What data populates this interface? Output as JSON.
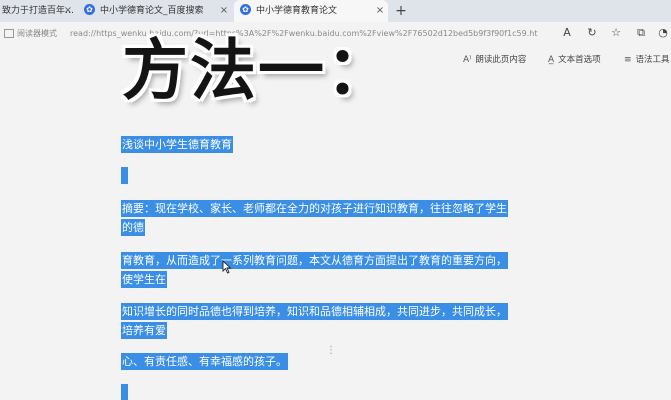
{
  "tabs": [
    {
      "label": "致力于打造百年…",
      "active": false
    },
    {
      "label": "中小学德育论文_百度搜索",
      "active": false
    },
    {
      "label": "中小学德育教育论文",
      "active": true
    }
  ],
  "tab_close_glyph": "×",
  "new_tab_glyph": "+",
  "address": {
    "reader_mode_label": "阅读器模式",
    "url": "read://https_wenku.baidu.com/?url=https%3A%2F%2Fwenku.baidu.com%2Fview%2F76502d12bed5b9f3f90f1c59.ht"
  },
  "toolbar_icons": [
    "read-aloud-icon",
    "refresh-icon",
    "favorites-icon",
    "collections-icon",
    "profile-icon"
  ],
  "toolbar": {
    "read_aloud_label": "朗读此页内容",
    "text_prefs_label": "文本首选项",
    "grammar_tools_label": "语法工具"
  },
  "overlay_title": "方法一：",
  "document": {
    "lines": [
      "浅谈中小学生德育教育",
      "摘要：现在学校、家长、老师都在全力的对孩子进行知识教育，往往忽略了学生",
      "的德",
      "育教育，从而造成了一系列教育问题，本文从德育方面提出了教育的重要方向，",
      "使学生在",
      "知识增长的同时品德也得到培养，知识和品德相辅相成，共同进步，共同成长，",
      "培养有爱",
      "心、有责任感、有幸福感的孩子。"
    ]
  },
  "colors": {
    "selection": "#3a8ee6",
    "tab_icon": "#2f6fe0",
    "page_bg": "#f3f3f3"
  }
}
